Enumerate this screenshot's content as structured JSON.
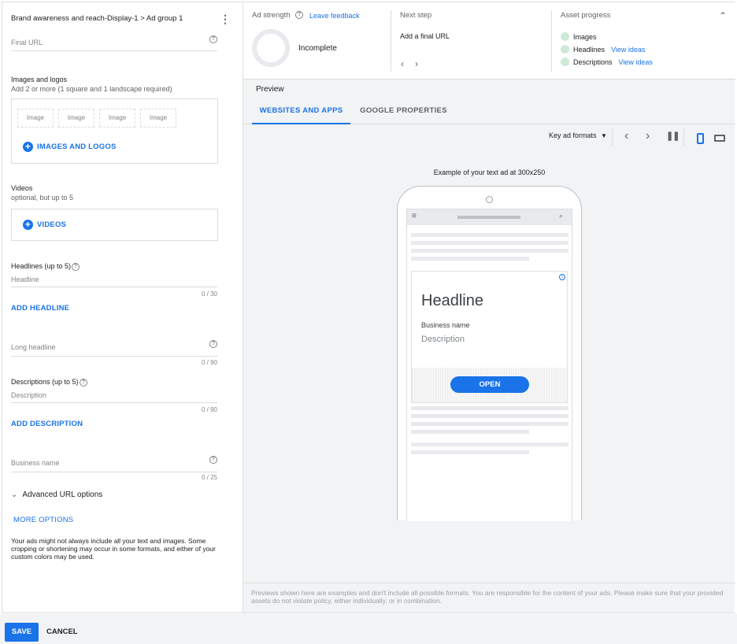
{
  "editor": {
    "breadcrumb": "Brand awareness and reach-Display-1 > Ad group 1",
    "final_url_placeholder": "Final URL",
    "images": {
      "title": "Images and logos",
      "subtitle": "Add 2 or more (1 square and 1 landscape required)",
      "slots": [
        "Image",
        "Image",
        "Image",
        "Image"
      ],
      "add_label": "IMAGES AND LOGOS"
    },
    "videos": {
      "title": "Videos",
      "subtitle": "optional, but up to 5",
      "add_label": "VIDEOS"
    },
    "headlines": {
      "title": "Headlines (up to 5)",
      "placeholder": "Headline",
      "counter": "0 / 30",
      "add_label": "ADD HEADLINE"
    },
    "long_headline": {
      "placeholder": "Long headline",
      "counter": "0 / 90"
    },
    "descriptions": {
      "title": "Descriptions (up to 5)",
      "placeholder": "Description",
      "counter": "0 / 90",
      "add_label": "ADD DESCRIPTION"
    },
    "business_name": {
      "placeholder": "Business name",
      "counter": "0 / 25"
    },
    "advanced_url_label": "Advanced URL options",
    "more_options_label": "MORE OPTIONS",
    "note": "Your ads might not always include all your text and images. Some cropping or shortening may occur in some formats, and either of your custom colors may be used."
  },
  "status_bar": {
    "ad_strength_label": "Ad strength",
    "leave_feedback": "Leave feedback",
    "strength_value": "Incomplete",
    "next_step_label": "Next step",
    "next_step_value": "Add a final URL",
    "asset_progress_label": "Asset progress",
    "assets": [
      {
        "name": "Images",
        "link": ""
      },
      {
        "name": "Headlines",
        "link": "View ideas"
      },
      {
        "name": "Descriptions",
        "link": "View ideas"
      }
    ]
  },
  "preview": {
    "label": "Preview",
    "tabs": [
      "WEBSITES AND APPS",
      "GOOGLE PROPERTIES"
    ],
    "format_select": "Key ad formats",
    "example_caption": "Example of your text ad at 300x250",
    "ad": {
      "headline": "Headline",
      "business": "Business name",
      "description": "Description",
      "cta": "OPEN"
    },
    "disclaimer": "Previews shown here are examples and don't include all possible formats. You are responsible for the content of your ads. Please make sure that your provided assets do not violate policy, either individually, or in combination."
  },
  "footer": {
    "save_label": "SAVE",
    "cancel_label": "CANCEL"
  },
  "colors": {
    "accent": "#1a73e8",
    "asset_dot": "#ceead6"
  }
}
